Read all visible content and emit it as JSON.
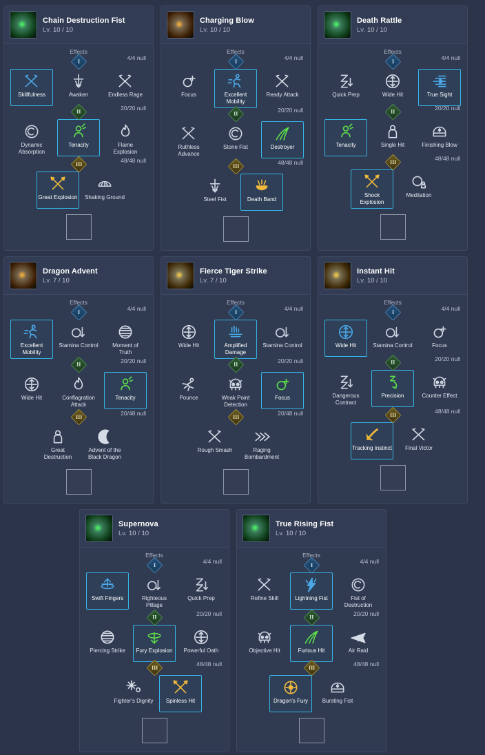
{
  "labels": {
    "effects": "Effects",
    "level_prefix": "Lv.",
    "tier_numerals": [
      "I",
      "II",
      "III"
    ]
  },
  "colors": {
    "selected_border": "#35b4e6",
    "bg": "#2b3448",
    "card": "#303a51"
  },
  "cards": [
    {
      "title": "Chain Destruction Fist",
      "level": "10 / 10",
      "icon_colors": [
        "#0d3b16",
        "#4dff6a"
      ],
      "tiers": [
        {
          "numeral": "I",
          "cap": "4/4 null",
          "nodes": [
            {
              "name": "Skillfulness",
              "icon": "blue-slash-icon",
              "selected": true,
              "color": "#4aa8e8"
            },
            {
              "name": "Awaken",
              "icon": "anchor-sword-icon",
              "selected": false,
              "color": "#c9d2dd"
            },
            {
              "name": "Endless Rage",
              "icon": "crossed-blades-icon",
              "selected": false,
              "color": "#d5dce6"
            }
          ]
        },
        {
          "numeral": "II",
          "cap": "20/20 null",
          "nodes": [
            {
              "name": "Dynamic Absorption",
              "icon": "swirl-orb-icon",
              "selected": false,
              "color": "#c9d2dd"
            },
            {
              "name": "Tenacity",
              "icon": "green-warrior-icon",
              "selected": true,
              "color": "#5ddc4a"
            },
            {
              "name": "Flame Explosion",
              "icon": "flame-icon",
              "selected": false,
              "color": "#d5dce6"
            }
          ]
        },
        {
          "numeral": "III",
          "cap": "48/48 null",
          "nodes": [
            {
              "name": "Great Explosion",
              "icon": "gold-crossed-swords-icon",
              "selected": true,
              "color": "#f0b93c"
            },
            {
              "name": "Shaking Ground",
              "icon": "ground-crack-icon",
              "selected": false,
              "color": "#c9d2dd"
            }
          ]
        }
      ]
    },
    {
      "title": "Charging Blow",
      "level": "10 / 10",
      "icon_colors": [
        "#3a1d02",
        "#ffb83d"
      ],
      "tiers": [
        {
          "numeral": "I",
          "cap": "4/4 null",
          "nodes": [
            {
              "name": "Focus",
              "icon": "orb-plus-icon",
              "selected": false,
              "color": "#d5dce6"
            },
            {
              "name": "Excellent Mobility",
              "icon": "blue-runner-icon",
              "selected": true,
              "color": "#4aa8e8"
            },
            {
              "name": "Ready Attack",
              "icon": "crossed-blades-icon",
              "selected": false,
              "color": "#d5dce6"
            }
          ]
        },
        {
          "numeral": "II",
          "cap": "20/20 null",
          "nodes": [
            {
              "name": "Ruthless Advance",
              "icon": "blue-slash-icon",
              "selected": false,
              "color": "#c9d2dd"
            },
            {
              "name": "Stone Fist",
              "icon": "swirl-orb-icon",
              "selected": false,
              "color": "#c9d2dd"
            },
            {
              "name": "Destroyer",
              "icon": "green-blades-icon",
              "selected": true,
              "color": "#5ddc4a"
            }
          ]
        },
        {
          "numeral": "III",
          "cap": "48/48 null",
          "nodes": [
            {
              "name": "Steel Fist",
              "icon": "anchor-sword-icon",
              "selected": false,
              "color": "#c9d2dd"
            },
            {
              "name": "Death Band",
              "icon": "gold-crown-icon",
              "selected": true,
              "color": "#f0b93c"
            }
          ]
        }
      ]
    },
    {
      "title": "Death Rattle",
      "level": "10 / 10",
      "icon_colors": [
        "#0d3b16",
        "#4dff6a"
      ],
      "tiers": [
        {
          "numeral": "I",
          "cap": "4/4 null",
          "nodes": [
            {
              "name": "Quick Prep",
              "icon": "hourglass-arrow-icon",
              "selected": false,
              "color": "#c9d2dd"
            },
            {
              "name": "Wide Hit",
              "icon": "expand-arrows-icon",
              "selected": false,
              "color": "#d5dce6"
            },
            {
              "name": "True Sight",
              "icon": "blue-burst-icon",
              "selected": true,
              "color": "#4aa8e8"
            }
          ]
        },
        {
          "numeral": "II",
          "cap": "20/20 null",
          "nodes": [
            {
              "name": "Tenacity",
              "icon": "green-warrior-icon",
              "selected": true,
              "color": "#5ddc4a"
            },
            {
              "name": "Single Hit",
              "icon": "figure-icon",
              "selected": false,
              "color": "#d5dce6"
            },
            {
              "name": "Finishing Blow",
              "icon": "helmet-icon",
              "selected": false,
              "color": "#c9d2dd"
            }
          ]
        },
        {
          "numeral": "III",
          "cap": "48/48 null",
          "nodes": [
            {
              "name": "Shock Explosion",
              "icon": "gold-crossed-swords-icon",
              "selected": true,
              "color": "#f0b93c"
            },
            {
              "name": "Meditation",
              "icon": "orb-figure-icon",
              "selected": false,
              "color": "#d5dce6"
            }
          ]
        }
      ]
    },
    {
      "title": "Dragon Advent",
      "level": "7 / 10",
      "icon_colors": [
        "#3a1d02",
        "#ffb83d"
      ],
      "tiers": [
        {
          "numeral": "I",
          "cap": "4/4 null",
          "nodes": [
            {
              "name": "Excellent Mobility",
              "icon": "blue-runner-icon",
              "selected": true,
              "color": "#4aa8e8"
            },
            {
              "name": "Stamina Control",
              "icon": "orb-arrow-icon",
              "selected": false,
              "color": "#c9d2dd"
            },
            {
              "name": "Moment of Truth",
              "icon": "sphere-icon",
              "selected": false,
              "color": "#d5dce6"
            }
          ]
        },
        {
          "numeral": "II",
          "cap": "20/20 null",
          "nodes": [
            {
              "name": "Wide Hit",
              "icon": "expand-arrows-icon",
              "selected": false,
              "color": "#d5dce6"
            },
            {
              "name": "Conflagration Attack",
              "icon": "flame-icon",
              "selected": false,
              "color": "#d5dce6"
            },
            {
              "name": "Tenacity",
              "icon": "green-warrior-icon",
              "selected": true,
              "color": "#5ddc4a"
            }
          ]
        },
        {
          "numeral": "III",
          "cap": "20/48 null",
          "nodes": [
            {
              "name": "Great Destruction",
              "icon": "figure-icon",
              "selected": false,
              "color": "#d5dce6"
            },
            {
              "name": "Advent of the Black Dragon",
              "icon": "moon-icon",
              "selected": false,
              "color": "#d5dce6"
            }
          ]
        }
      ]
    },
    {
      "title": "Fierce Tiger Strike",
      "level": "7 / 10",
      "icon_colors": [
        "#3a2502",
        "#ffd24d"
      ],
      "tiers": [
        {
          "numeral": "I",
          "cap": "4/4 null",
          "nodes": [
            {
              "name": "Wide Hit",
              "icon": "expand-arrows-icon",
              "selected": false,
              "color": "#d5dce6"
            },
            {
              "name": "Amplified Damage",
              "icon": "blue-amp-icon",
              "selected": true,
              "color": "#4aa8e8"
            },
            {
              "name": "Stamina Control",
              "icon": "orb-arrow-icon",
              "selected": false,
              "color": "#c9d2dd"
            }
          ]
        },
        {
          "numeral": "II",
          "cap": "20/20 null",
          "nodes": [
            {
              "name": "Pounce",
              "icon": "pounce-icon",
              "selected": false,
              "color": "#d5dce6"
            },
            {
              "name": "Weak Point Detection",
              "icon": "skull-icon",
              "selected": false,
              "color": "#c9d2dd"
            },
            {
              "name": "Focus",
              "icon": "green-orb-plus-icon",
              "selected": true,
              "color": "#5ddc4a"
            }
          ]
        },
        {
          "numeral": "III",
          "cap": "20/48 null",
          "nodes": [
            {
              "name": "Rough Smash",
              "icon": "crossed-blades-icon",
              "selected": false,
              "color": "#d5dce6"
            },
            {
              "name": "Raging Bombardment",
              "icon": "chevrons-icon",
              "selected": false,
              "color": "#d5dce6"
            }
          ]
        }
      ]
    },
    {
      "title": "Instant Hit",
      "level": "10 / 10",
      "icon_colors": [
        "#3a2502",
        "#ffd24d"
      ],
      "tiers": [
        {
          "numeral": "I",
          "cap": "4/4 null",
          "nodes": [
            {
              "name": "Wide Hit",
              "icon": "blue-expand-arrows-icon",
              "selected": true,
              "color": "#4aa8e8"
            },
            {
              "name": "Stamina Control",
              "icon": "orb-arrow-icon",
              "selected": false,
              "color": "#c9d2dd"
            },
            {
              "name": "Focus",
              "icon": "orb-plus-icon",
              "selected": false,
              "color": "#d5dce6"
            }
          ]
        },
        {
          "numeral": "II",
          "cap": "20/20 null",
          "nodes": [
            {
              "name": "Dangerous Contract",
              "icon": "hourglass-arrow-icon",
              "selected": false,
              "color": "#c9d2dd"
            },
            {
              "name": "Precision",
              "icon": "green-sleep-icon",
              "selected": true,
              "color": "#5ddc4a"
            },
            {
              "name": "Counter Effect",
              "icon": "skull-icon",
              "selected": false,
              "color": "#c9d2dd"
            }
          ]
        },
        {
          "numeral": "III",
          "cap": "48/48 null",
          "nodes": [
            {
              "name": "Tracking Instinct",
              "icon": "gold-arrow-icon",
              "selected": true,
              "color": "#f0b93c"
            },
            {
              "name": "Final Victor",
              "icon": "blue-slash-icon",
              "selected": false,
              "color": "#d5dce6"
            }
          ]
        }
      ]
    },
    {
      "title": "Supernova",
      "level": "10 / 10",
      "icon_colors": [
        "#0d3b16",
        "#4dff6a"
      ],
      "tiers": [
        {
          "numeral": "I",
          "cap": "4/4 null",
          "nodes": [
            {
              "name": "Swift Fingers",
              "icon": "blue-ring-icon",
              "selected": true,
              "color": "#4aa8e8"
            },
            {
              "name": "Righteous Pillage",
              "icon": "orb-arrow-icon",
              "selected": false,
              "color": "#c9d2dd"
            },
            {
              "name": "Quick Prep",
              "icon": "hourglass-arrow-icon",
              "selected": false,
              "color": "#c9d2dd"
            }
          ]
        },
        {
          "numeral": "II",
          "cap": "20/20 null",
          "nodes": [
            {
              "name": "Piercing Strike",
              "icon": "sphere-icon",
              "selected": false,
              "color": "#d5dce6"
            },
            {
              "name": "Fury Explosion",
              "icon": "green-ring-icon",
              "selected": true,
              "color": "#5ddc4a"
            },
            {
              "name": "Powerful Oath",
              "icon": "expand-arrows-icon",
              "selected": false,
              "color": "#d5dce6"
            }
          ]
        },
        {
          "numeral": "III",
          "cap": "48/48 null",
          "nodes": [
            {
              "name": "Fighter's Dignity",
              "icon": "sparkle-icon",
              "selected": false,
              "color": "#d5dce6"
            },
            {
              "name": "Spinless Hit",
              "icon": "gold-crossed-swords-icon",
              "selected": true,
              "color": "#f0b93c"
            }
          ]
        }
      ]
    },
    {
      "title": "True Rising Fist",
      "level": "10 / 10",
      "icon_colors": [
        "#0d3b16",
        "#4dff6a"
      ],
      "tiers": [
        {
          "numeral": "I",
          "cap": "4/4 null",
          "nodes": [
            {
              "name": "Refine Skill",
              "icon": "crossed-blades-icon",
              "selected": false,
              "color": "#d5dce6"
            },
            {
              "name": "Lightning Fist",
              "icon": "blue-lightning-icon",
              "selected": true,
              "color": "#4aa8e8"
            },
            {
              "name": "Fist of Destruction",
              "icon": "swirl-orb-icon",
              "selected": false,
              "color": "#c9d2dd"
            }
          ]
        },
        {
          "numeral": "II",
          "cap": "20/20 null",
          "nodes": [
            {
              "name": "Objective Hit",
              "icon": "skull-icon",
              "selected": false,
              "color": "#c9d2dd"
            },
            {
              "name": "Furious Hit",
              "icon": "green-blades-icon",
              "selected": true,
              "color": "#5ddc4a"
            },
            {
              "name": "Air Raid",
              "icon": "plane-icon",
              "selected": false,
              "color": "#d5dce6"
            }
          ]
        },
        {
          "numeral": "III",
          "cap": "48/48 null",
          "nodes": [
            {
              "name": "Dragon's Fury",
              "icon": "gold-radial-icon",
              "selected": true,
              "color": "#f0b93c"
            },
            {
              "name": "Bursting Fist",
              "icon": "helmet-icon",
              "selected": false,
              "color": "#c9d2dd"
            }
          ]
        }
      ]
    }
  ]
}
